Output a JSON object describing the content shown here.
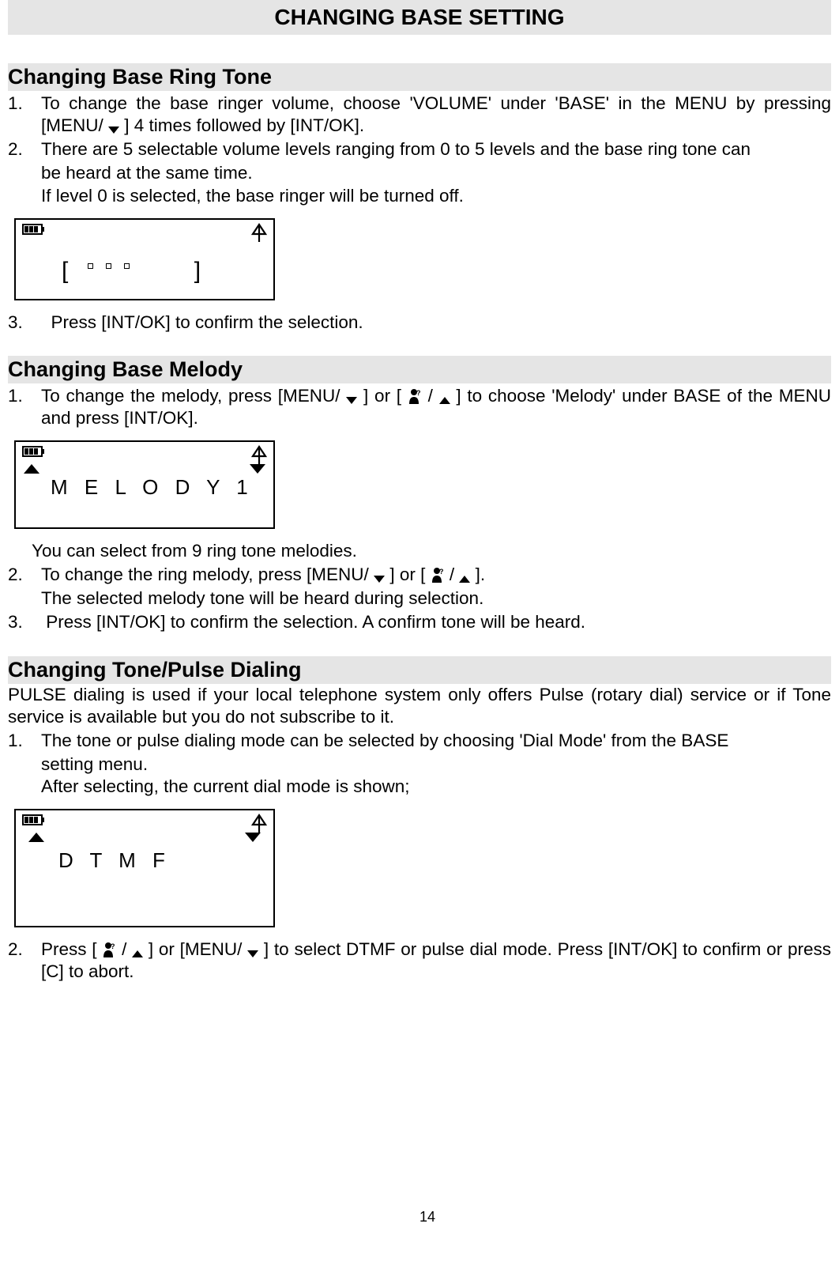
{
  "page_title": "CHANGING BASE SETTING",
  "page_number": "14",
  "sections": {
    "ring_tone": {
      "heading": "Changing Base Ring Tone",
      "item1_marker": "1.",
      "item1_text_a": "To change the base ringer volume, choose 'VOLUME' under 'BASE' in the MENU by pressing [MENU/",
      "item1_text_b": "] 4 times followed by [INT/OK].",
      "item2_marker": "2.",
      "item2_text": "There are 5 selectable volume levels ranging from 0 to 5 levels and the base ring tone can",
      "item2_sub1": "be heard at the same time.",
      "item2_sub2": "If level 0 is selected, the base ringer will be turned off.",
      "item3_marker": "3.",
      "item3_text": "Press [INT/OK] to confirm the selection.",
      "lcd": {
        "volume_left_bracket": "[",
        "volume_right_bracket": "]"
      }
    },
    "melody": {
      "heading": "Changing Base Melody",
      "item1_marker": "1.",
      "item1_a": "To change the melody, press [MENU/",
      "item1_b": "] or [",
      "item1_c": "/",
      "item1_d": "] to choose 'Melody' under BASE of the MENU and press [INT/OK].",
      "lcd_line": "M E L O D Y    1",
      "after_lcd": "You can select from 9 ring tone melodies.",
      "item2_marker": "2.",
      "item2_a": "To change the ring melody, press [MENU/",
      "item2_b": "] or [",
      "item2_c": "/",
      "item2_d": "].",
      "item2_sub": "The selected melody tone will be heard during selection.",
      "item3_marker": "3.",
      "item3_text": "Press [INT/OK] to confirm the selection. A confirm tone will be heard."
    },
    "dial": {
      "heading": "Changing Tone/Pulse Dialing",
      "intro": "PULSE dialing is used if your local telephone system only offers Pulse (rotary dial) service or if Tone service is available but you do not subscribe to it.",
      "item1_marker": "1.",
      "item1_text": "The tone or pulse dialing mode can be selected by choosing 'Dial Mode' from the BASE",
      "item1_sub1": "setting menu.",
      "item1_sub2": "After selecting, the current dial mode is shown;",
      "lcd_line": "D T M F",
      "item2_marker": "2.",
      "item2_a": "Press [",
      "item2_b": "/",
      "item2_c": "] or [MENU/",
      "item2_d": "] to select DTMF or pulse dial mode. Press [INT/OK] to confirm or press [C] to abort."
    }
  }
}
